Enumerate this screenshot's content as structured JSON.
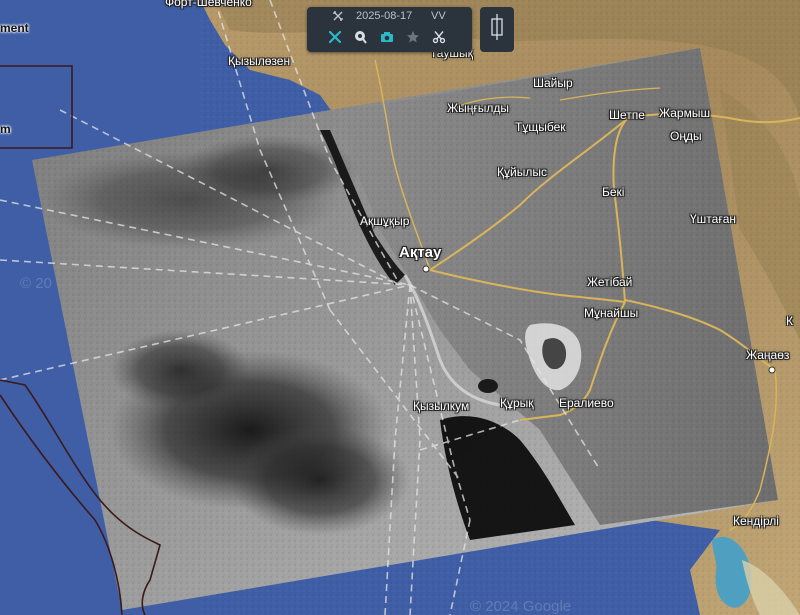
{
  "toolbar": {
    "date": "2025-08-17",
    "polarization": "VV",
    "accent_color": "#2bb8c8",
    "icons": [
      "tools-icon",
      "fullscreen-close-icon",
      "map-pin-icon",
      "camera-icon",
      "star-icon",
      "scissors-icon"
    ]
  },
  "side_button": {
    "icon": "compare-slider-icon"
  },
  "places": {
    "aktau": "Ақтау",
    "fort_shevchenko": "Форт-Шевченко",
    "kyzyloozen": "Қызылөзен",
    "taushyk": "Таушық",
    "shaiyr": "Шайыр",
    "zhyngyldy": "Жыңғылды",
    "tushchybek": "Тұщыбек",
    "shetpe": "Шетпе",
    "zharmysh": "Жармыш",
    "ondy": "Оңды",
    "kuiylys": "Құйылыс",
    "beki": "Бекі",
    "ushtagan": "Үштаған",
    "akshukyr": "Ақшұқыр",
    "zhetibai": "Жетібай",
    "munaishy": "Мұнайшы",
    "zhanaozen": "Жаңаөз",
    "kyzylkum": "Қызылкум",
    "kuryk": "Құрық",
    "eraliyevo": "Ералиево",
    "kendirli": "Кендірлі"
  },
  "partial_labels": {
    "ment": "ment",
    "m": "m",
    "k": "К"
  },
  "watermarks": [
    "© 20",
    "© 2024 Google"
  ]
}
